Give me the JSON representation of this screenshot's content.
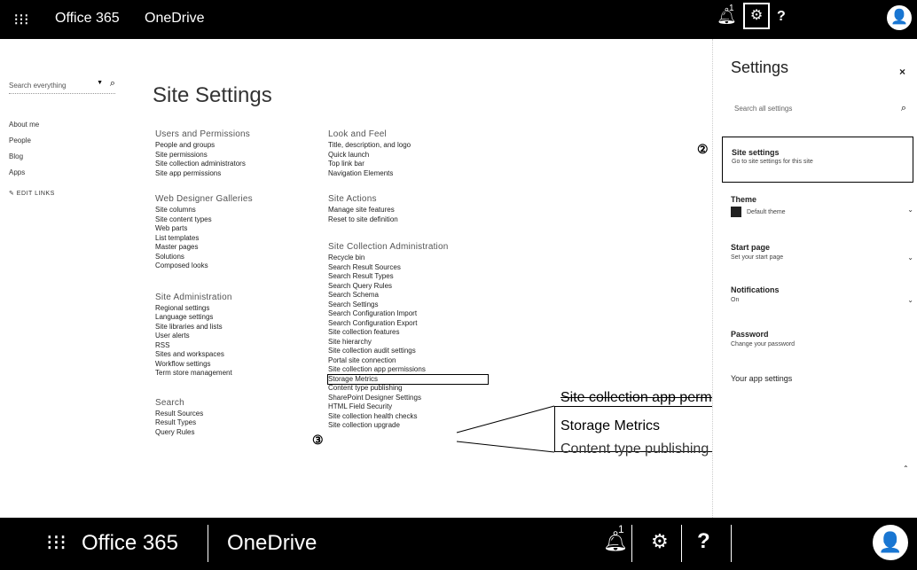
{
  "topbar": {
    "waffle_icon": "⁝⁝⁝",
    "brand": "Office 365",
    "app": "OneDrive",
    "notification_count": "1",
    "gear_glyph": "⚙",
    "help_glyph": "?",
    "avatar_glyph": "👤"
  },
  "callouts": {
    "one": "①",
    "two": "②",
    "three": "③"
  },
  "leftnav": {
    "search_placeholder": "Search everything",
    "items": [
      "About me",
      "People",
      "Blog",
      "Apps"
    ],
    "edit_links": "✎ EDIT LINKS"
  },
  "page_title": "Site Settings",
  "columns": {
    "users": {
      "title": "Users and Permissions",
      "links": [
        "People and groups",
        "Site permissions",
        "Site collection administrators",
        "Site app permissions"
      ]
    },
    "web_designer": {
      "title": "Web Designer Galleries",
      "links": [
        "Site columns",
        "Site content types",
        "Web parts",
        "List templates",
        "Master pages",
        "Solutions",
        "Composed looks"
      ]
    },
    "site_admin": {
      "title": "Site Administration",
      "links": [
        "Regional settings",
        "Language settings",
        "Site libraries and lists",
        "User alerts",
        "RSS",
        "Sites and workspaces",
        "Workflow settings",
        "Term store management"
      ]
    },
    "search": {
      "title": "Search",
      "links": [
        "Result Sources",
        "Result Types",
        "Query Rules"
      ]
    },
    "look_feel": {
      "title": "Look and Feel",
      "links": [
        "Title, description, and logo",
        "Quick launch",
        "Top link bar",
        "Navigation Elements"
      ]
    },
    "site_actions": {
      "title": "Site Actions",
      "links": [
        "Manage site features",
        "Reset to site definition"
      ]
    },
    "site_collection_admin": {
      "title": "Site Collection Administration",
      "links": [
        "Recycle bin",
        "Search Result Sources",
        "Search Result Types",
        "Search Query Rules",
        "Search Schema",
        "Search Settings",
        "Search Configuration Import",
        "Search Configuration Export",
        "Site collection features",
        "Site hierarchy",
        "Site collection audit settings",
        "Portal site connection",
        "Site collection app permissions",
        "Storage Metrics",
        "Content type publishing",
        "SharePoint Designer Settings",
        "HTML Field Security",
        "Site collection health checks",
        "Site collection upgrade"
      ]
    }
  },
  "zoom": {
    "above": "Site collection app permissions",
    "main": "Storage Metrics",
    "below": "Content type publishing"
  },
  "panel": {
    "title": "Settings",
    "close": "×",
    "search_placeholder": "Search all settings",
    "site_settings": {
      "title": "Site settings",
      "desc": "Go to site settings for this site"
    },
    "theme": {
      "title": "Theme",
      "value": "Default theme"
    },
    "start_page": {
      "title": "Start page",
      "desc": "Set your start page"
    },
    "notifications": {
      "title": "Notifications",
      "desc": "On"
    },
    "password": {
      "title": "Password",
      "desc": "Change your password"
    },
    "app_settings": {
      "title": "Your app settings"
    }
  },
  "bottombar": {
    "waffle_icon": "⁝⁝⁝",
    "brand": "Office 365",
    "app": "OneDrive",
    "notification_count": "1",
    "gear_glyph": "⚙",
    "help_glyph": "?",
    "avatar_glyph": "👤"
  }
}
